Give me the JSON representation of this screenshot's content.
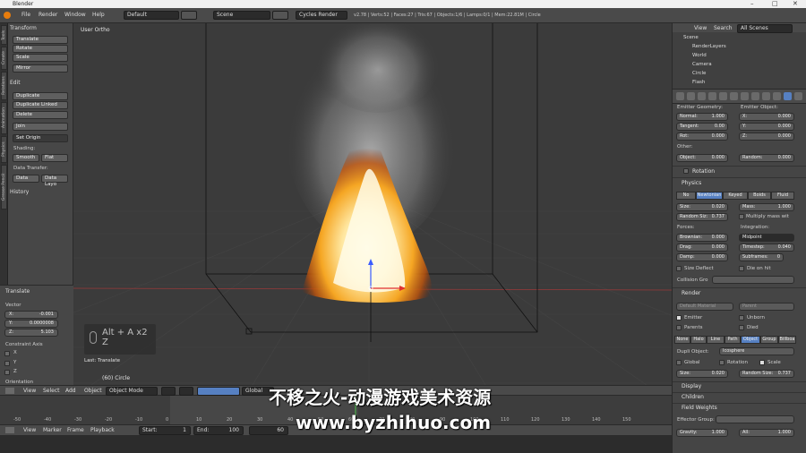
{
  "window": {
    "title": "Blender",
    "controls": [
      "–",
      "□",
      "✕"
    ]
  },
  "infobar": {
    "menus": [
      "File",
      "Render",
      "Window",
      "Help"
    ],
    "layout": "Default",
    "scene": "Scene",
    "engine": "Cycles Render",
    "stats": "v2.78 | Verts:52 | Faces:27 | Tris:67 | Objects:1/6 | Lamps:0/1 | Mem:22.81M | Circle"
  },
  "vtabs": [
    "Tools",
    "Create",
    "Relations",
    "Animation",
    "Physics",
    "Grease Pencil"
  ],
  "tools": {
    "transform_header": "Transform",
    "transform_buttons": [
      "Translate",
      "Rotate",
      "Scale",
      "Mirror"
    ],
    "edit_header": "Edit",
    "edit_buttons": [
      "Duplicate",
      "Duplicate Linked",
      "Delete",
      "Join"
    ],
    "set_origin": "Set Origin",
    "shading_label": "Shading:",
    "smooth": "Smooth",
    "flat": "Flat",
    "data_transfer_label": "Data Transfer:",
    "data": "Data",
    "data_layo": "Data Layo",
    "history": "History"
  },
  "redo": {
    "header": "Translate",
    "vector_label": "Vector",
    "x_label": "X:",
    "x": "-0.001",
    "y_label": "Y:",
    "y": "0.0000008",
    "z_label": "Z:",
    "z": "5.103",
    "constraint_label": "Constraint Axis",
    "axes": [
      "X",
      "Y",
      "Z"
    ],
    "orientation": "Orientation"
  },
  "viewport": {
    "view_name": "User Ortho",
    "key_line1": "Alt + A x2",
    "key_line2": "Z",
    "last_op": "Last: Translate",
    "object_label": "(60) Circle"
  },
  "view3d_header": {
    "menus": [
      "View",
      "Select",
      "Add",
      "Object"
    ],
    "mode": "Object Mode",
    "orientation": "Global"
  },
  "timeline": {
    "ticks": [
      "-50",
      "-40",
      "-30",
      "-20",
      "-10",
      "0",
      "10",
      "20",
      "30",
      "40",
      "50",
      "60",
      "70",
      "80",
      "90",
      "100",
      "110",
      "120",
      "130",
      "140",
      "150"
    ],
    "menus": [
      "View",
      "Marker",
      "Frame",
      "Playback"
    ],
    "start_label": "Start:",
    "start": "1",
    "end_label": "End:",
    "end": "100",
    "current": "60"
  },
  "outliner": {
    "menus": [
      "View",
      "Search"
    ],
    "scene_dropdown": "All Scenes",
    "items": [
      "Scene",
      "RenderLayers",
      "World",
      "Camera",
      "Circle",
      "Flash"
    ]
  },
  "properties": {
    "emitter_geometry": "Emitter Geometry:",
    "emitter_object": "Emitter Object:",
    "normal_label": "Normal:",
    "normal": "1.000",
    "tangent_label": "Tangent:",
    "tangent": "0.00",
    "rot_label": "Rot:",
    "rot": "0.000",
    "ex_label": "X:",
    "ex": "0.000",
    "ey_label": "Y:",
    "ey": "0.000",
    "ez_label": "Z:",
    "ez": "0.000",
    "other": "Other:",
    "object_label": "Object:",
    "object": "0.000",
    "random_label": "Random:",
    "random": "0.000",
    "rotation_panel": "Rotation",
    "physics_panel": "Physics",
    "physics_types": [
      "No",
      "Newtonian",
      "Keyed",
      "Boids",
      "Fluid"
    ],
    "size_label": "Size:",
    "size": "0.020",
    "mass_label": "Mass:",
    "mass": "1.000",
    "random_size_label": "Random Siz:",
    "random_size": "0.737",
    "multiply_mass": "Multiply mass wit",
    "forces_label": "Forces:",
    "integration_label": "Integration:",
    "brownian_label": "Brownian:",
    "brownian": "0.000",
    "drag_label": "Drag:",
    "drag": "0.000",
    "damp_label": "Damp:",
    "damp": "0.000",
    "midpoint": "Midpoint",
    "timestep_label": "Timestep:",
    "timestep": "0.040",
    "subframes_label": "Subframes:",
    "subframes": "0",
    "size_deflect": "Size Deflect",
    "die_on_hit": "Die on hit",
    "collision_grp": "Collision Gro",
    "render_panel": "Render",
    "material": "Default Material",
    "parent": "Parent",
    "emitter": "Emitter",
    "unborn": "Unborn",
    "parents": "Parents",
    "died": "Died",
    "render_types": [
      "None",
      "Halo",
      "Line",
      "Path",
      "Object",
      "Group",
      "Billboa"
    ],
    "dupli_object_label": "Dupli Object:",
    "dupli_object": "Icosphere",
    "global": "Global",
    "rotation": "Rotation",
    "scale": "Scale",
    "render_size_label": "Size:",
    "render_size": "0.020",
    "render_random_label": "Random Size:",
    "render_random": "0.737",
    "display_panel": "Display",
    "children_panel": "Children",
    "field_weights_panel": "Field Weights",
    "effector_group": "Effector Group:",
    "gravity_label": "Gravity:",
    "gravity": "1.000",
    "all_label": "All:",
    "all": "1.000"
  },
  "watermark": {
    "line1": "不移之火-动漫游戏美术资源",
    "line2": "www.byzhihuo.com"
  }
}
